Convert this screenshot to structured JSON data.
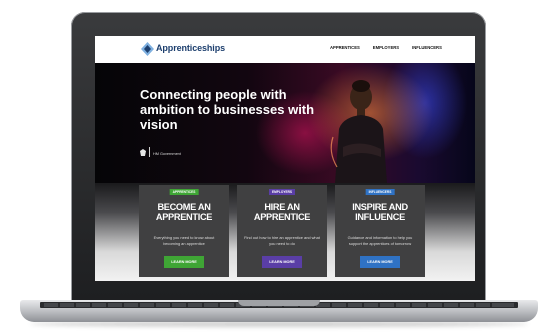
{
  "header": {
    "logo_text": "Apprenticeships",
    "nav": [
      "APPRENTICES",
      "EMPLOYERS",
      "INFLUENCERS"
    ]
  },
  "hero": {
    "title": "Connecting people with ambition to businesses with vision",
    "gov_label": "HM Government"
  },
  "cards": [
    {
      "tag": "APPRENTICES",
      "title": "BECOME AN APPRENTICE",
      "description": "Everything you need to know about becoming an apprentice",
      "button": "LEARN MORE",
      "color": "#3fa535"
    },
    {
      "tag": "EMPLOYERS",
      "title": "HIRE AN APPRENTICE",
      "description": "Find out how to hire an apprentice and what you need to do",
      "button": "LEARN MORE",
      "color": "#5a3ea6"
    },
    {
      "tag": "INFLUENCERS",
      "title": "INSPIRE AND INFLUENCE",
      "description": "Guidance and information to help you support the apprentices of tomorrow",
      "button": "LEARN MORE",
      "color": "#2f72c4"
    }
  ]
}
